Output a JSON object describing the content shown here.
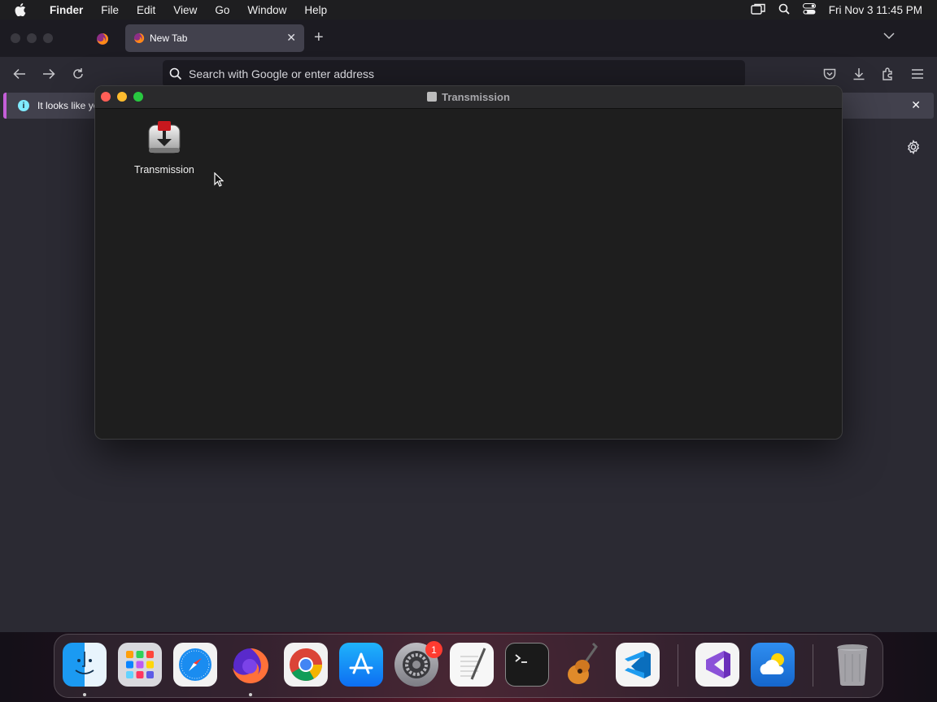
{
  "menubar": {
    "app_name": "Finder",
    "items": [
      "File",
      "Edit",
      "View",
      "Go",
      "Window",
      "Help"
    ],
    "datetime": "Fri Nov 3  11:45 PM"
  },
  "browser": {
    "tab_title": "New Tab",
    "url_placeholder": "Search with Google or enter address",
    "notification_text": "It looks like yo"
  },
  "finder": {
    "window_title": "Transmission",
    "files": [
      {
        "label": "Transmission",
        "icon": "transmission-app-icon"
      }
    ]
  },
  "dock": {
    "apps": [
      "Finder",
      "Launchpad",
      "Safari",
      "Firefox",
      "Chrome",
      "App Store",
      "System Settings",
      "TextEdit",
      "Terminal",
      "GarageBand",
      "Visual Studio Code",
      "Visual Studio",
      "Weather",
      "Trash"
    ],
    "settings_badge": "1"
  },
  "colors": {
    "accent_notification": "#c45ed8",
    "traffic_red": "#ff5f57",
    "traffic_yellow": "#febc2e",
    "traffic_green": "#28c840",
    "badge_red": "#ff3b30"
  }
}
